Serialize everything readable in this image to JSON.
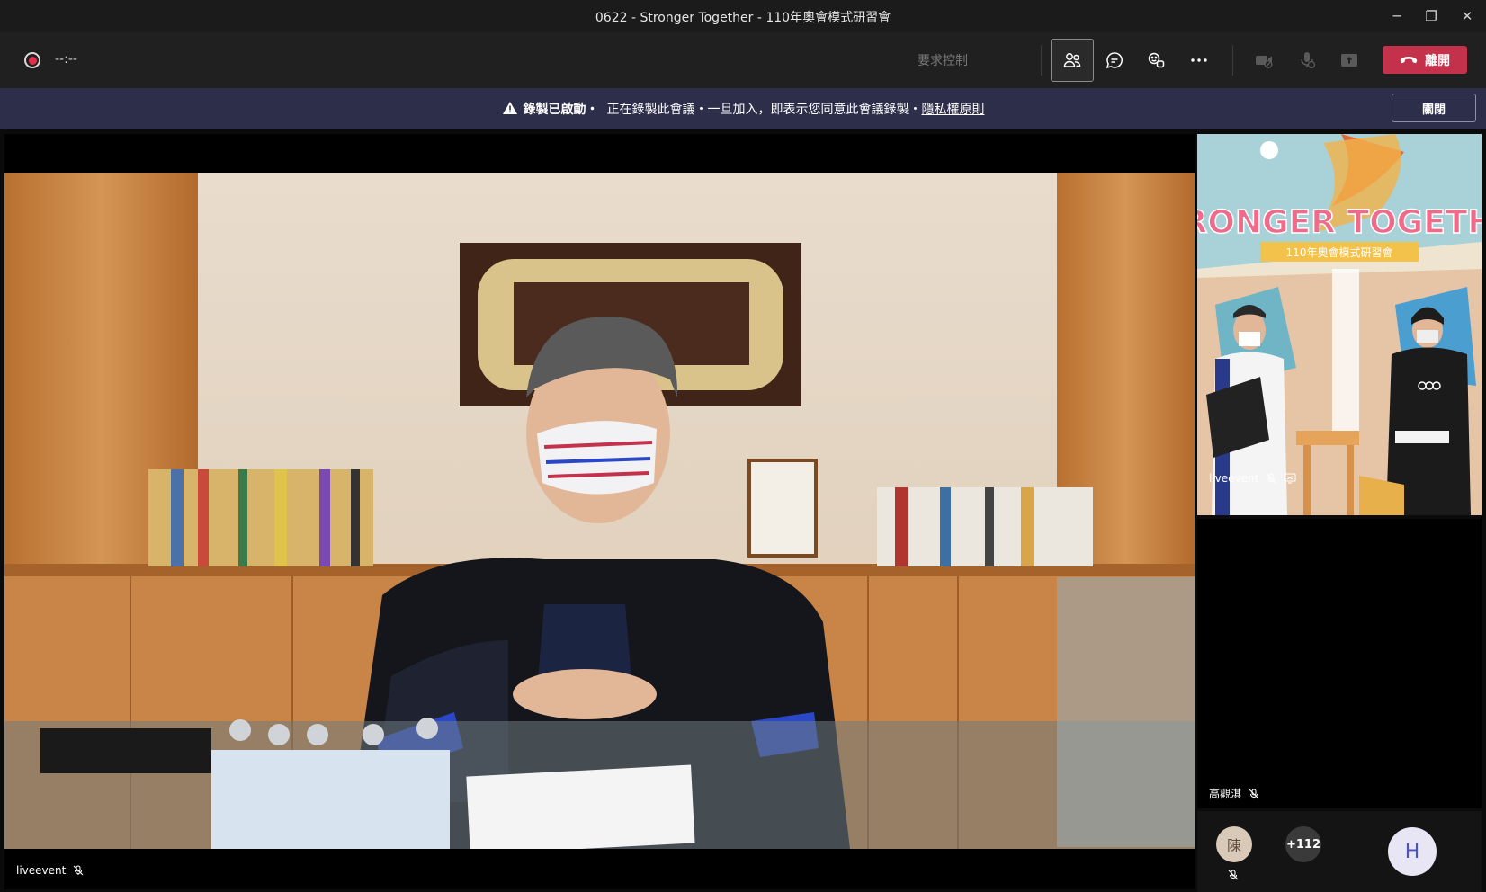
{
  "window": {
    "title": "0622 - Stronger Together - 110年奧會模式研習會",
    "minimize_glyph": "─",
    "maximize_glyph": "❐",
    "close_glyph": "✕"
  },
  "toolbar": {
    "timer": "--:--",
    "request_control": "要求控制",
    "leave_label": "離開",
    "icons": [
      "participants-icon",
      "chat-icon",
      "reactions-icon",
      "more-icon",
      "camera-off-icon",
      "mic-off-icon",
      "share-icon"
    ]
  },
  "banner": {
    "strong": "錄製已啟動・",
    "message": "正在錄製此會議・一旦加入，即表示您同意此會議錄製・",
    "link": "隱私權原則",
    "close_label": "關閉"
  },
  "main_video": {
    "participant_name": "liveevent"
  },
  "side_tiles": [
    {
      "participant_name": "liveevent",
      "slide_title": "STRONGER TOGETHER",
      "slide_subtitle": "110年奧會模式研習會"
    },
    {
      "participant_name": "高觀淇"
    }
  ],
  "roster": {
    "avatar1_initial": "陳",
    "overflow_count": "+112",
    "avatar2_initial": "H"
  },
  "colors": {
    "leave_red": "#c4314b",
    "banner_bg": "#2d2f4a",
    "toolbar_bg": "#202020"
  }
}
